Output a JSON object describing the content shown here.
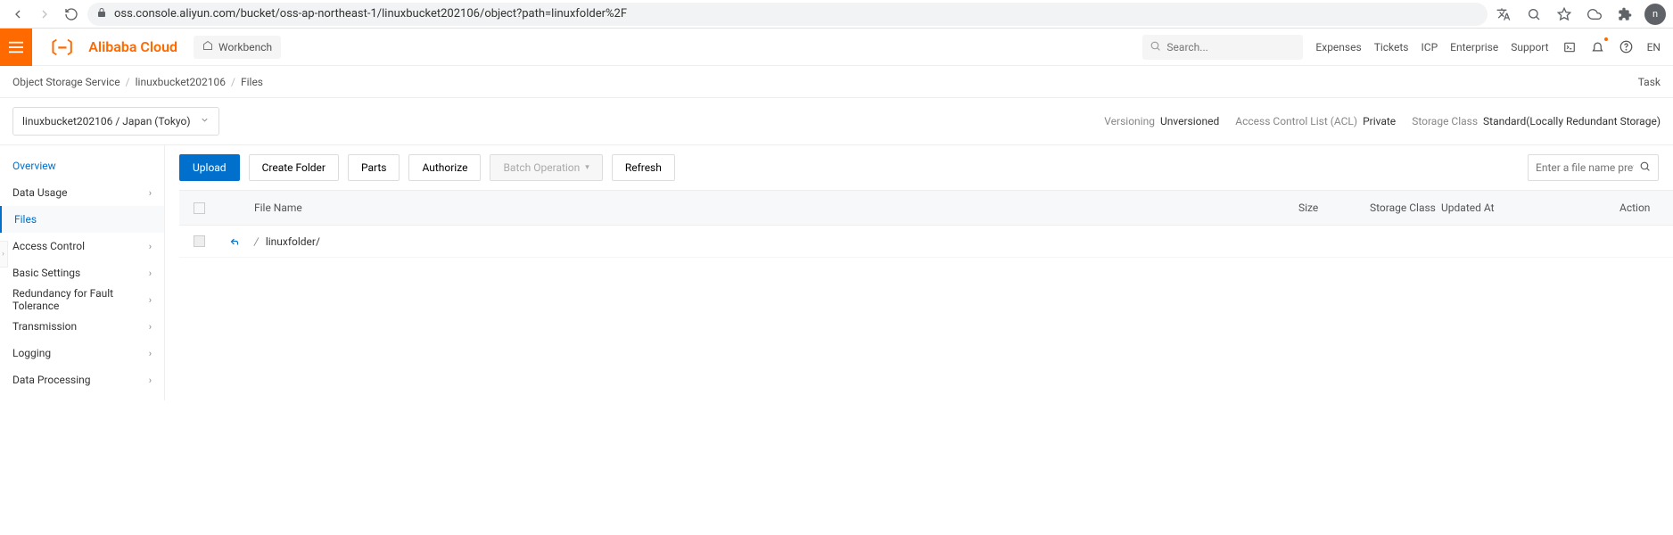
{
  "browser": {
    "url": "oss.console.aliyun.com/bucket/oss-ap-northeast-1/linuxbucket202106/object?path=linuxfolder%2F",
    "avatar_letter": "n"
  },
  "header": {
    "brand": "Alibaba Cloud",
    "workbench": "Workbench",
    "search_placeholder": "Search...",
    "links": [
      "Expenses",
      "Tickets",
      "ICP",
      "Enterprise",
      "Support"
    ],
    "lang": "EN"
  },
  "breadcrumb": {
    "items": [
      "Object Storage Service",
      "linuxbucket202106",
      "Files"
    ],
    "task": "Task"
  },
  "bucket_selector": "linuxbucket202106 / Japan (Tokyo)",
  "info": {
    "versioning_label": "Versioning",
    "versioning_value": "Unversioned",
    "acl_label": "Access Control List (ACL)",
    "acl_value": "Private",
    "storage_label": "Storage Class",
    "storage_value": "Standard(Locally Redundant Storage)"
  },
  "sidebar": {
    "items": [
      {
        "label": "Overview",
        "active": true,
        "expandable": false
      },
      {
        "label": "Data Usage",
        "expandable": true
      },
      {
        "label": "Files",
        "link": true
      },
      {
        "label": "Access Control",
        "expandable": true
      },
      {
        "label": "Basic Settings",
        "expandable": true
      },
      {
        "label": "Redundancy for Fault Tolerance",
        "expandable": true
      },
      {
        "label": "Transmission",
        "expandable": true
      },
      {
        "label": "Logging",
        "expandable": true
      },
      {
        "label": "Data Processing",
        "expandable": true
      }
    ]
  },
  "toolbar": {
    "upload": "Upload",
    "create_folder": "Create Folder",
    "parts": "Parts",
    "authorize": "Authorize",
    "batch": "Batch Operation",
    "refresh": "Refresh",
    "file_search_placeholder": "Enter a file name prefix"
  },
  "table": {
    "cols": {
      "file_name": "File Name",
      "size": "Size",
      "storage_class": "Storage Class",
      "updated_at": "Updated At",
      "action": "Action"
    },
    "row_name": "linuxfolder/"
  }
}
